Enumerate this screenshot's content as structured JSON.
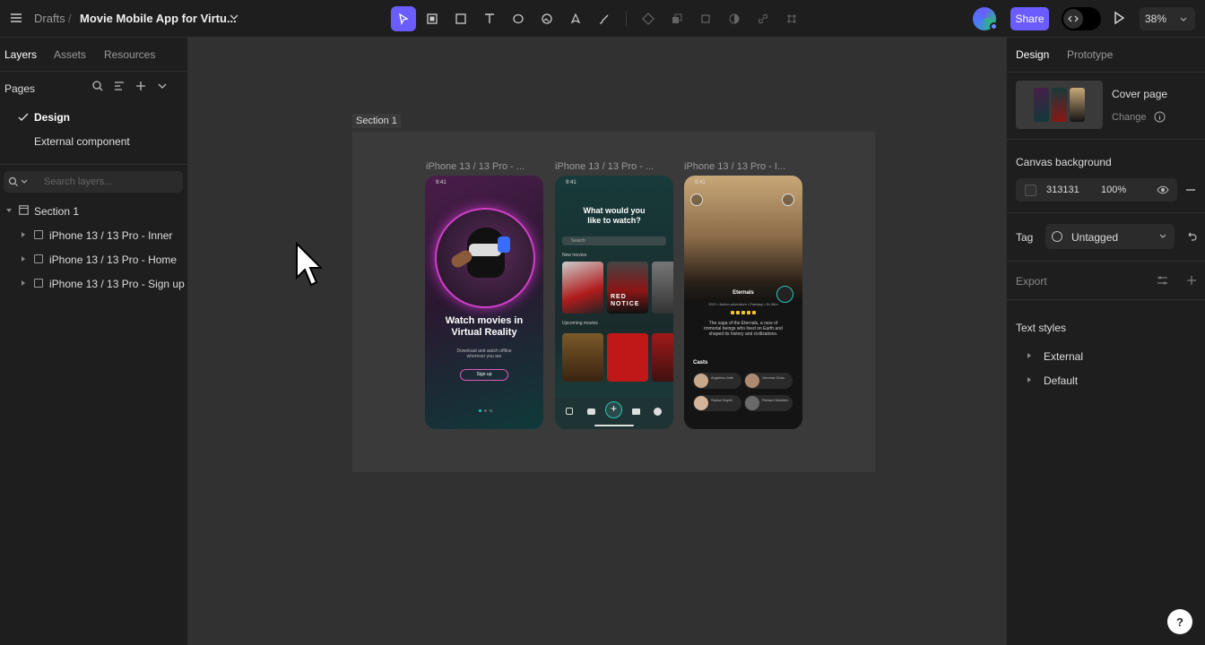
{
  "topbar": {
    "breadcrumb": "Drafts",
    "separator": "/",
    "project_title": "Movie Mobile App for Virtu...",
    "share_label": "Share",
    "zoom": "38%"
  },
  "left_panel": {
    "tabs": [
      "Layers",
      "Assets",
      "Resources"
    ],
    "pages_title": "Pages",
    "pages": [
      {
        "label": "Design",
        "active": true
      },
      {
        "label": "External component",
        "active": false
      }
    ],
    "search_placeholder": "Search layers...",
    "layers": [
      {
        "label": "Section 1"
      },
      {
        "label": "iPhone 13 / 13 Pro - Inner"
      },
      {
        "label": "iPhone 13 / 13 Pro - Home"
      },
      {
        "label": "iPhone 13 / 13 Pro - Sign up"
      }
    ]
  },
  "canvas": {
    "background": "#313131",
    "section_label": "Section 1",
    "frames": [
      {
        "label": "iPhone 13 / 13 Pro - ...",
        "time": "9:41",
        "headline": "Watch movies in Virtual Reality",
        "subtext": "Download and watch offline wherever you are",
        "button": "Sign up"
      },
      {
        "label": "iPhone 13 / 13 Pro - ...",
        "time": "9:41",
        "headline": "What would you like to watch?",
        "search": "Search",
        "section_new": "New movies",
        "section_upcoming": "Upcoming movies",
        "poster_text": "RED NOTICE"
      },
      {
        "label": "iPhone 13 / 13 Pro - I...",
        "time": "9:41",
        "title": "Eternals",
        "meta": "2021 • Action-adventure • Fantasy • 2h 36m",
        "description": "The saga of the Eternals, a race of immortal beings who lived on Earth and shaped its history and civilizations.",
        "casts_title": "Casts",
        "casts": [
          "Angelina Jolie",
          "Gemma Chan",
          "Salma Hayek",
          "Richard Madden"
        ]
      }
    ]
  },
  "right_panel": {
    "tabs": [
      "Design",
      "Prototype"
    ],
    "cover_title": "Cover page",
    "cover_change": "Change",
    "canvas_bg_title": "Canvas background",
    "canvas_bg_hex": "313131",
    "canvas_bg_opacity": "100%",
    "tag_title": "Tag",
    "tag_value": "Untagged",
    "export_title": "Export",
    "text_styles_title": "Text styles",
    "text_styles": [
      "External",
      "Default"
    ]
  },
  "colors": {
    "accent": "#6a5cff",
    "panel_bg": "#1e1e1e",
    "canvas_bg": "#313131"
  }
}
